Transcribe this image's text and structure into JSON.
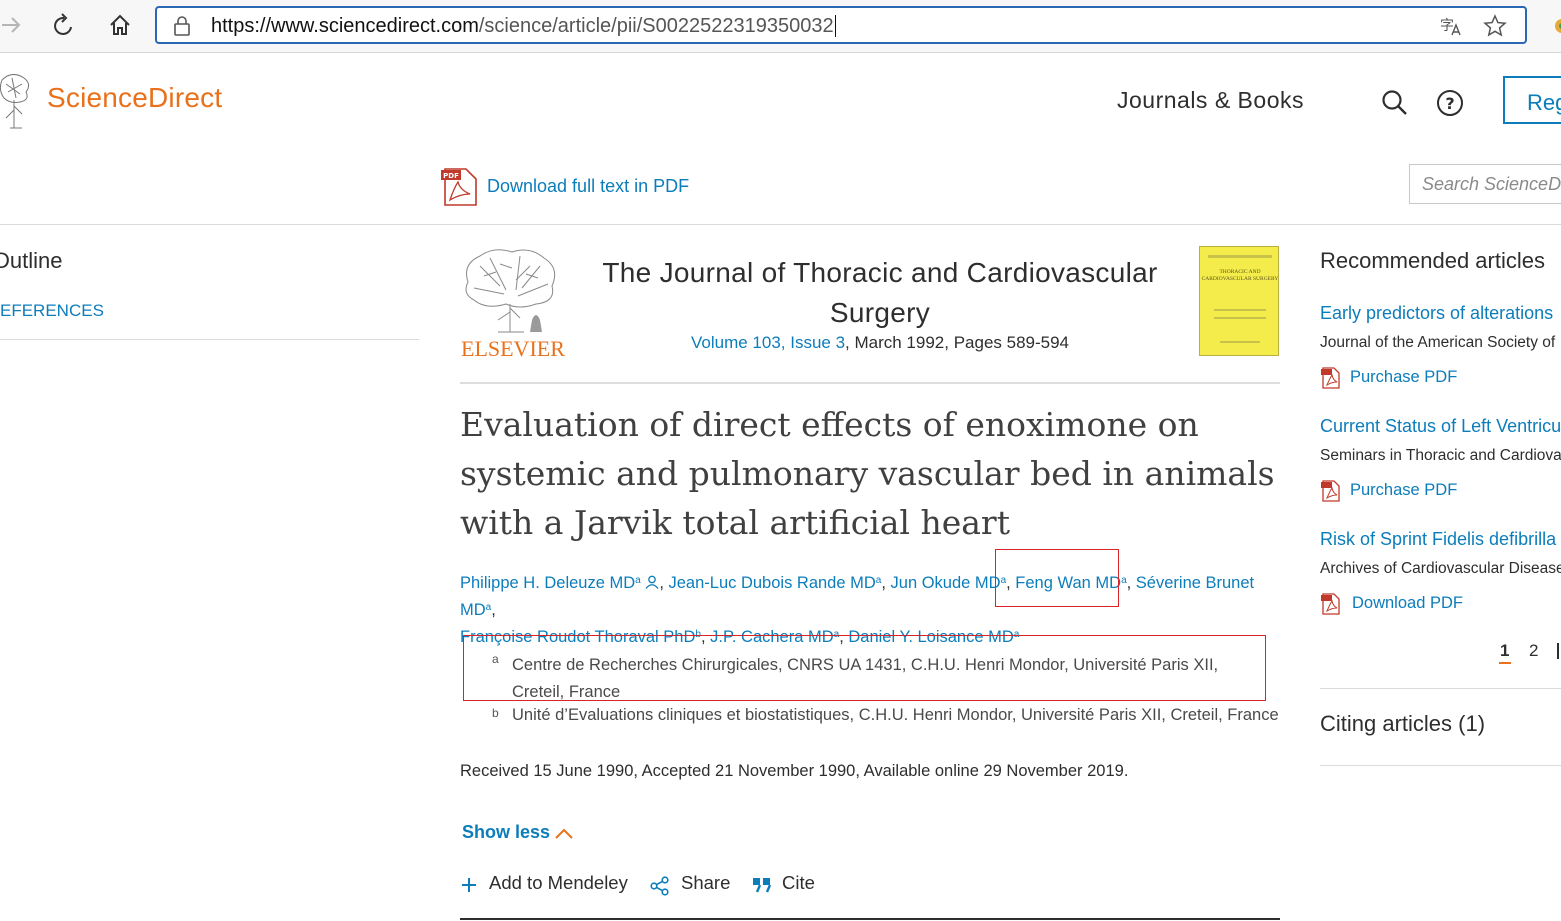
{
  "browser": {
    "url_host": "https://www.sciencedirect.com",
    "url_path": "/science/article/pii/S0022522319350032",
    "icons": [
      "forward-icon",
      "reload-icon",
      "home-icon",
      "lock-icon",
      "translate-icon",
      "favorite-star-icon"
    ]
  },
  "header": {
    "brand": "ScienceDirect",
    "nav_journals": "Journals & Books",
    "register": "Reg",
    "icons": [
      "search-icon",
      "help-icon"
    ]
  },
  "toolbar": {
    "download_pdf": "Download full text in PDF",
    "search_placeholder": "Search ScienceDi"
  },
  "outline": {
    "title": "Outline",
    "title_visible": "Dutline",
    "references": "EFERENCES"
  },
  "journal": {
    "title": "The Journal of Thoracic and Cardiovascular Surgery",
    "volume_issue": "Volume 103, Issue 3",
    "date_pages": ", March 1992, Pages 589-594",
    "publisher": "ELSEVIER",
    "cover_text": "THORACIC AND CARDIOVASCULAR SURGERY"
  },
  "article": {
    "title": "Evaluation of direct effects of enoximone on systemic and pulmonary vascular bed in animals with a Jarvik total artificial heart",
    "authors": [
      {
        "name": "Philippe H. Deleuze MD",
        "sup": "a"
      },
      {
        "name": "Jean-Luc Dubois Rande MD",
        "sup": "a"
      },
      {
        "name": "Jun Okude MD",
        "sup": "a"
      },
      {
        "name": "Feng Wan MD",
        "sup": "a"
      },
      {
        "name": "Séverine Brunet MD",
        "sup": "a"
      },
      {
        "name": "Françoise Roudot Thoraval PhD",
        "sup": "b"
      },
      {
        "name": "J.P. Cachera MD",
        "sup": "a"
      },
      {
        "name": "Daniel Y. Loisance MD",
        "sup": "a"
      }
    ],
    "affiliations": [
      {
        "sup": "a",
        "text": "Centre de Recherches Chirurgicales, CNRS UA 1431, C.H.U. Henri Mondor, Université Paris XII, Creteil, France"
      },
      {
        "sup": "b",
        "text": "Unité d’Evaluations cliniques et biostatistiques, C.H.U. Henri Mondor, Université Paris XII, Creteil, France"
      }
    ],
    "history": "Received 15 June 1990, Accepted 21 November 1990, Available online 29 November 2019.",
    "show_less": "Show less",
    "actions": {
      "mendeley": "Add to Mendeley",
      "share": "Share",
      "cite": "Cite"
    }
  },
  "recommended": {
    "title": "Recommended articles",
    "items": [
      {
        "title": "Early predictors of alterations",
        "source": "Journal of the American Society of",
        "pdf": "Purchase PDF"
      },
      {
        "title": "Current Status of Left Ventricu",
        "source": "Seminars in Thoracic and Cardiova",
        "pdf": "Purchase PDF"
      },
      {
        "title": "Risk of Sprint Fidelis defibrilla",
        "source": "Archives of Cardiovascular Disease",
        "pdf": "Download PDF"
      }
    ],
    "pages": [
      "1",
      "2"
    ],
    "citing": "Citing articles (1)"
  },
  "colors": {
    "brand_orange": "#e9711c",
    "link_blue": "#0c7dbb",
    "highlight_red": "#d8232a",
    "url_focus": "#2b67b3"
  }
}
